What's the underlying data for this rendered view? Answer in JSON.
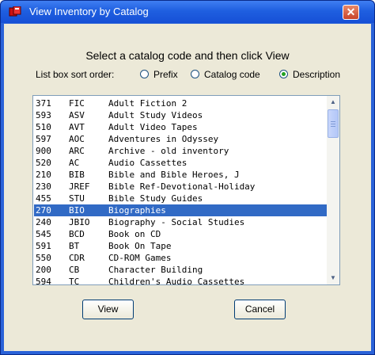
{
  "window": {
    "title": "View Inventory by Catalog"
  },
  "dialog": {
    "heading": "Select a catalog code and then click View",
    "sort_label": "List box sort order:",
    "sort_options": [
      {
        "label": "Prefix",
        "checked": false
      },
      {
        "label": "Catalog code",
        "checked": false
      },
      {
        "label": "Description",
        "checked": true
      }
    ]
  },
  "catalog_list": {
    "selected_index": 9,
    "rows": [
      {
        "num": "371",
        "code": "FIC",
        "description": "Adult Fiction 2"
      },
      {
        "num": "593",
        "code": "ASV",
        "description": "Adult Study Videos"
      },
      {
        "num": "510",
        "code": "AVT",
        "description": "Adult Video Tapes"
      },
      {
        "num": "597",
        "code": "AOC",
        "description": "Adventures in Odyssey"
      },
      {
        "num": "900",
        "code": "ARC",
        "description": "Archive - old inventory"
      },
      {
        "num": "520",
        "code": "AC",
        "description": "Audio Cassettes"
      },
      {
        "num": "210",
        "code": "BIB",
        "description": "Bible and Bible Heroes, J"
      },
      {
        "num": "230",
        "code": "JREF",
        "description": "Bible Ref-Devotional-Holiday"
      },
      {
        "num": "455",
        "code": "STU",
        "description": "Bible Study Guides"
      },
      {
        "num": "270",
        "code": "BIO",
        "description": "Biographies"
      },
      {
        "num": "240",
        "code": "JBIO",
        "description": "Biography - Social Studies"
      },
      {
        "num": "545",
        "code": "BCD",
        "description": "Book on CD"
      },
      {
        "num": "591",
        "code": "BT",
        "description": "Book On Tape"
      },
      {
        "num": "550",
        "code": "CDR",
        "description": "CD-ROM Games"
      },
      {
        "num": "200",
        "code": "CB",
        "description": "Character Building"
      },
      {
        "num": "594",
        "code": "TC",
        "description": "Children's Audio Cassettes"
      }
    ]
  },
  "buttons": {
    "view": "View",
    "cancel": "Cancel"
  },
  "icons": {
    "close": "close-icon",
    "app": "app-icon"
  },
  "colors": {
    "titlebar": "#1f5fe0",
    "selection": "#316ac5",
    "dialog_bg": "#ece9d8"
  }
}
